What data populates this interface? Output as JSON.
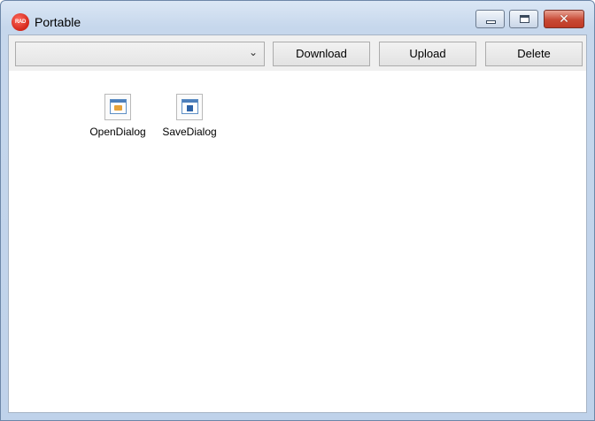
{
  "window": {
    "title": "Portable",
    "app_icon_text": "RAD"
  },
  "toolbar": {
    "combo_value": "",
    "download_label": "Download",
    "upload_label": "Upload",
    "delete_label": "Delete"
  },
  "components": [
    {
      "label": "OpenDialog",
      "icon": "open-dialog-icon"
    },
    {
      "label": "SaveDialog",
      "icon": "save-dialog-icon"
    }
  ],
  "colors": {
    "close_button": "#c84a35",
    "titlebar": "#c6d7ec"
  }
}
